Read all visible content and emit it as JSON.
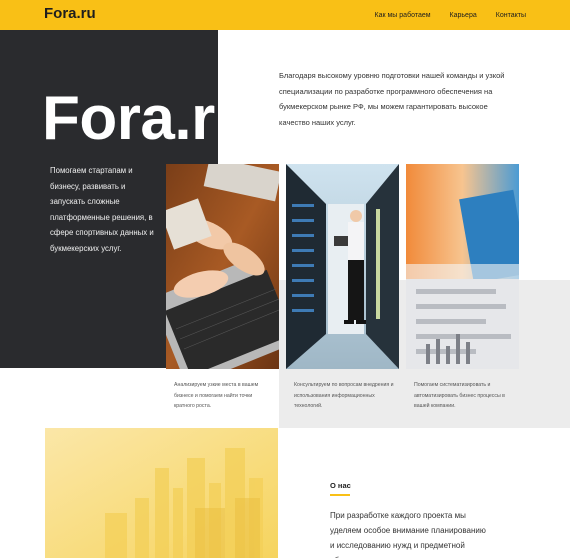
{
  "header": {
    "logo": "Fora.ru",
    "nav": [
      "Как мы работаем",
      "Карьера",
      "Контакты"
    ]
  },
  "hero": {
    "big_title": "Fora.ru",
    "intro": "Благодаря высокому уровню подготовки нашей команды и узкой специализации по разработке программного обеспечения на букмекерском рынке РФ, мы можем гарантировать высокое качество наших услуг.",
    "side_text": "Помогаем стартапам и бизнесу, развивать и запускать сложные платформенные решения, в сфере спортивных данных и букмекерских услуг."
  },
  "services": [
    {
      "photo": "laptop-typing-photo",
      "caption": "Анализируем узкие места в вашем бизнесе и помогаем найти точки кратного роста."
    },
    {
      "photo": "server-room-photo",
      "caption": "Консультируем по вопросам внедрения и использования информационных технологий."
    },
    {
      "photo": "analytics-charts-photo",
      "caption": "Помогаем систематизировать и автоматизировать бизнес процессы в вашей компании."
    }
  ],
  "about": {
    "heading": "О нас",
    "text": "При разработке каждого проекта мы уделяем особое внимание планированию и исследованию нужд и предметной области"
  },
  "colors": {
    "accent": "#f9c016",
    "dark": "#2a2b2e",
    "light_gray": "#ececec"
  }
}
